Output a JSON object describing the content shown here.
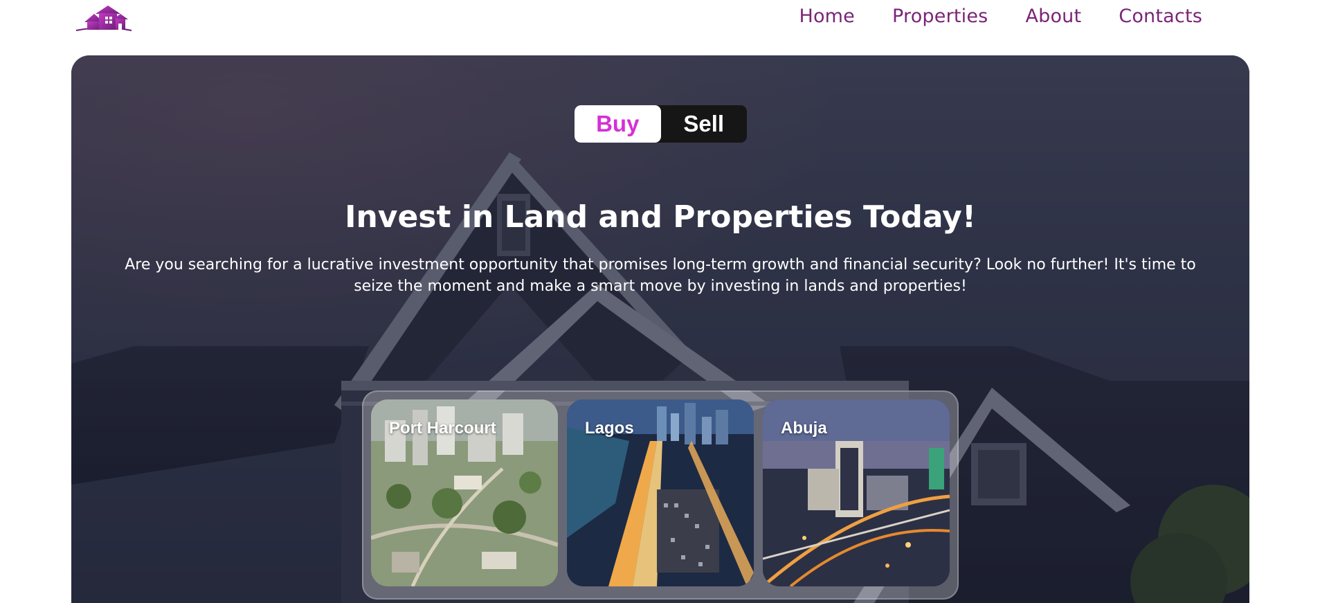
{
  "nav": {
    "items": [
      "Home",
      "Properties",
      "About",
      "Contacts"
    ]
  },
  "colors": {
    "brand": "#7a2477",
    "accent": "#d530d6"
  },
  "logo_icon": "house-logo-icon",
  "toggle": {
    "buy_label": "Buy",
    "sell_label": "Sell",
    "selected": "Buy"
  },
  "hero": {
    "title": "Invest in Land and Properties Today!",
    "description": "Are you searching for a lucrative investment opportunity that promises long-term growth and financial security? Look no further! It's time to seize the moment and make a smart move by investing in lands and properties!"
  },
  "cities": [
    {
      "name": "Port Harcourt"
    },
    {
      "name": "Lagos"
    },
    {
      "name": "Abuja"
    }
  ]
}
